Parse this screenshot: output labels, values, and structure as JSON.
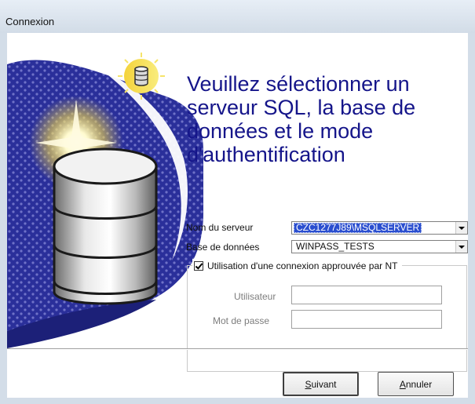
{
  "window": {
    "title": "Connexion"
  },
  "heading": {
    "lines": [
      "Veuillez sélectionner un",
      "serveur SQL, la base de",
      "données et le mode",
      "d'authentification"
    ]
  },
  "form": {
    "server": {
      "label": "Nom du serveur",
      "value": "CZC1277J89\\MSQLSERVER"
    },
    "database": {
      "label": "Base de données",
      "value": "WINPASS_TESTS"
    },
    "nt_auth": {
      "label": "Utilisation d'une connexion approuvée par NT",
      "checked": true
    },
    "user": {
      "label": "Utilisateur",
      "value": ""
    },
    "password": {
      "label": "Mot de passe",
      "value": ""
    }
  },
  "buttons": {
    "next": {
      "access_key": "S",
      "rest": "uivant"
    },
    "cancel": {
      "access_key": "A",
      "rest": "nnuler"
    }
  },
  "icons": [
    "database-icon",
    "database-bulb-icon",
    "dropdown-arrow-icon",
    "checkbox-icon"
  ],
  "colors": {
    "heading": "#15158a",
    "art_blue": "#2a2f9a",
    "selection": "#2a4ecf"
  }
}
